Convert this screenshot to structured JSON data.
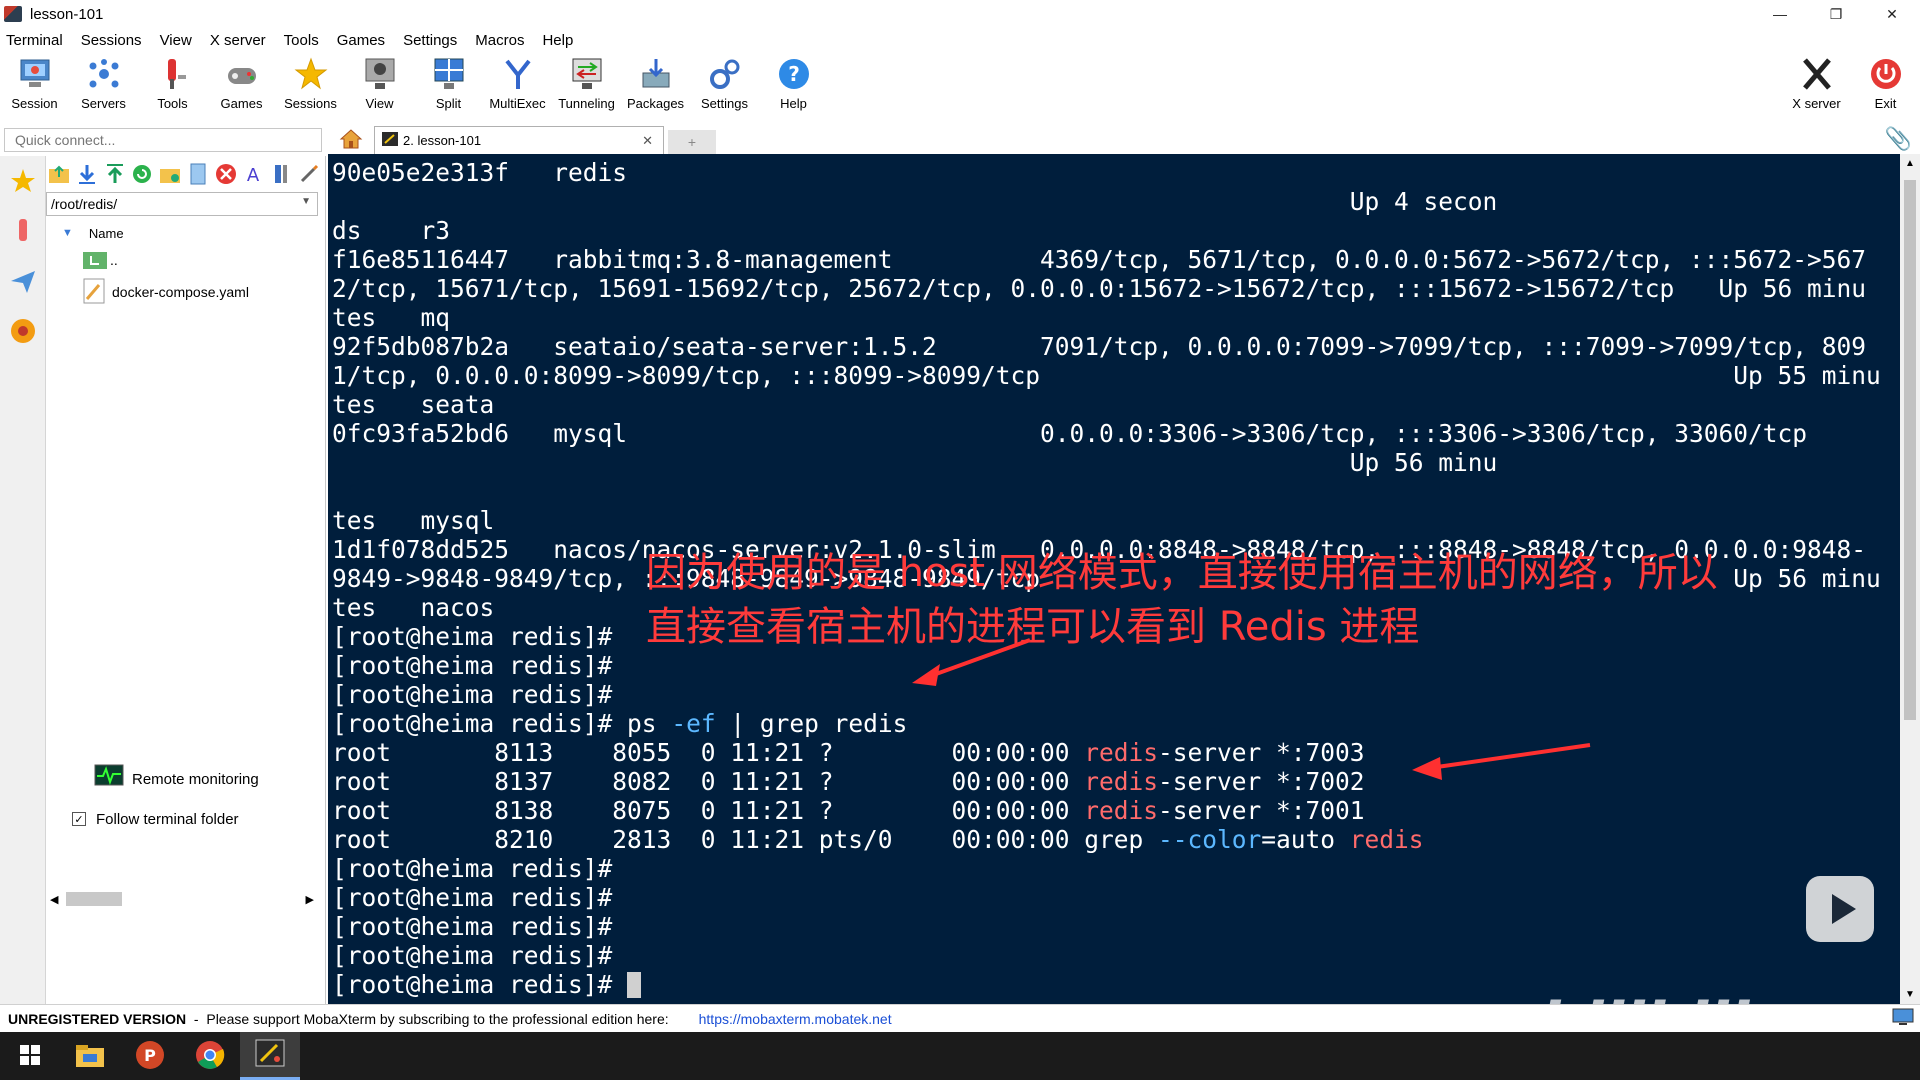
{
  "window": {
    "title": "lesson-101",
    "minimize": "—",
    "restore": "❐",
    "close": "✕"
  },
  "menu": [
    "Terminal",
    "Sessions",
    "View",
    "X server",
    "Tools",
    "Games",
    "Settings",
    "Macros",
    "Help"
  ],
  "toolbar": {
    "session": "Session",
    "servers": "Servers",
    "tools": "Tools",
    "games": "Games",
    "sessions": "Sessions",
    "view": "View",
    "split": "Split",
    "multiexec": "MultiExec",
    "tunneling": "Tunneling",
    "packages": "Packages",
    "settings": "Settings",
    "help": "Help",
    "xserver": "X server",
    "exit": "Exit"
  },
  "quick_connect": {
    "placeholder": "Quick connect..."
  },
  "sftp": {
    "path": "/root/redis/",
    "column_name": "Name",
    "parent": "..",
    "file": "docker-compose.yaml",
    "remote_monitoring": "Remote monitoring",
    "follow_terminal_folder": "Follow terminal folder"
  },
  "tabs": {
    "active_label": "2. lesson-101",
    "close": "✕",
    "new": "+"
  },
  "terminal": {
    "l01": "90e05e2e313f   redis",
    "l02a": "                                                                     ",
    "l02": "Up 4 secon",
    "l03": "ds    r3",
    "l04": "f16e85116447   rabbitmq:3.8-management          4369/tcp, 5671/tcp, 0.0.0.0:5672->5672/tcp, :::5672->567",
    "l05": "2/tcp, 15671/tcp, 15691-15692/tcp, 25672/tcp, 0.0.0.0:15672->15672/tcp, :::15672->15672/tcp   Up 56 minu",
    "l06": "tes   mq",
    "l07": "92f5db087b2a   seataio/seata-server:1.5.2       7091/tcp, 0.0.0.0:7099->7099/tcp, :::7099->7099/tcp, 809",
    "l08": "1/tcp, 0.0.0.0:8099->8099/tcp, :::8099->8099/tcp                                               Up 55 minu",
    "l09": "tes   seata",
    "l10": "0fc93fa52bd6   mysql                            0.0.0.0:3306->3306/tcp, :::3306->3306/tcp, 33060/tcp",
    "l11": "Up 56 minu",
    "l12": "tes   mysql",
    "l13": "1d1f078dd525   nacos/nacos-server:v2.1.0-slim   0.0.0.0:8848->8848/tcp, :::8848->8848/tcp, 0.0.0.0:9848-",
    "l14": "9849->9848-9849/tcp, :::9848-9849->9848-9849/tcp                                               Up 56 minu",
    "l15": "tes   nacos",
    "prompt": "[root@heima redis]#",
    "cmd_ps": "ps",
    "cmd_ef": "-ef",
    "cmd_rest": "| grep redis",
    "p1_pre": "root       8113    8055  0 11:21 ?        00:00:00 ",
    "p1_post": "-server *:7003",
    "p2_pre": "root       8137    8082  0 11:21 ?        00:00:00 ",
    "p2_post": "-server *:7002",
    "p3_pre": "root       8138    8075  0 11:21 ?        00:00:00 ",
    "p3_post": "-server *:7001",
    "p4_pre": "root       8210    2813  0 11:21 pts/0    00:00:00 grep ",
    "p4_flag": "--color",
    "p4_eq": "=auto ",
    "redis": "redis"
  },
  "annotation": {
    "line1": "因为使用的是 host 网络模式，直接使用宿主机的网络，所以",
    "line2": "直接查看宿主机的进程可以看到 Redis 进程",
    "color": "#ff3b3b"
  },
  "status": {
    "unregistered": "UNREGISTERED VERSION",
    "message": "  -  Please support MobaXterm by subscribing to the professional edition here:",
    "link": "https://mobaxterm.mobatek.net"
  },
  "watermark": {
    "logo": "bilibili"
  },
  "colors": {
    "terminal_bg": "#001e3c",
    "highlight_red": "#ff6b6b",
    "highlight_blue": "#5cb8ff"
  }
}
